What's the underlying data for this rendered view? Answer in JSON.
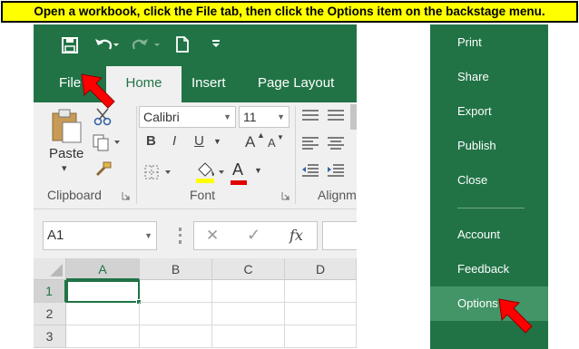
{
  "instruction": "Open a workbook, click the File tab, then click the Options item on the backstage menu.",
  "qat": {
    "save_icon": "save-icon",
    "undo_icon": "undo-icon",
    "redo_icon": "redo-icon",
    "new_icon": "new-file-icon",
    "customize_icon": "customize-qat-icon"
  },
  "tabs": {
    "file": "File",
    "home": "Home",
    "insert": "Insert",
    "page_layout": "Page Layout"
  },
  "ribbon": {
    "paste": "Paste",
    "paste_dropdown": "▾",
    "font_name": "Calibri",
    "font_size": "11",
    "bold": "B",
    "italic": "I",
    "underline": "U",
    "grow_font": "A",
    "shrink_font": "A",
    "font_color": "A",
    "clipboard_label": "Clipboard",
    "font_label": "Font",
    "alignment_label": "Alignm"
  },
  "formula_bar": {
    "name_box": "A1",
    "cancel": "✕",
    "enter": "✓",
    "fx": "fx"
  },
  "sheet": {
    "columns": [
      "A",
      "B",
      "C",
      "D"
    ],
    "rows": [
      "1",
      "2",
      "3"
    ],
    "selected_cell": "A1"
  },
  "backstage": {
    "items": [
      "Print",
      "Share",
      "Export",
      "Publish",
      "Close"
    ],
    "lower_items": [
      "Account",
      "Feedback",
      "Options"
    ],
    "selected": "Options"
  },
  "colors": {
    "excel_green": "#217346",
    "banner_yellow": "#ffff00",
    "arrow_red": "#ff0000",
    "selected_item": "#439467"
  }
}
